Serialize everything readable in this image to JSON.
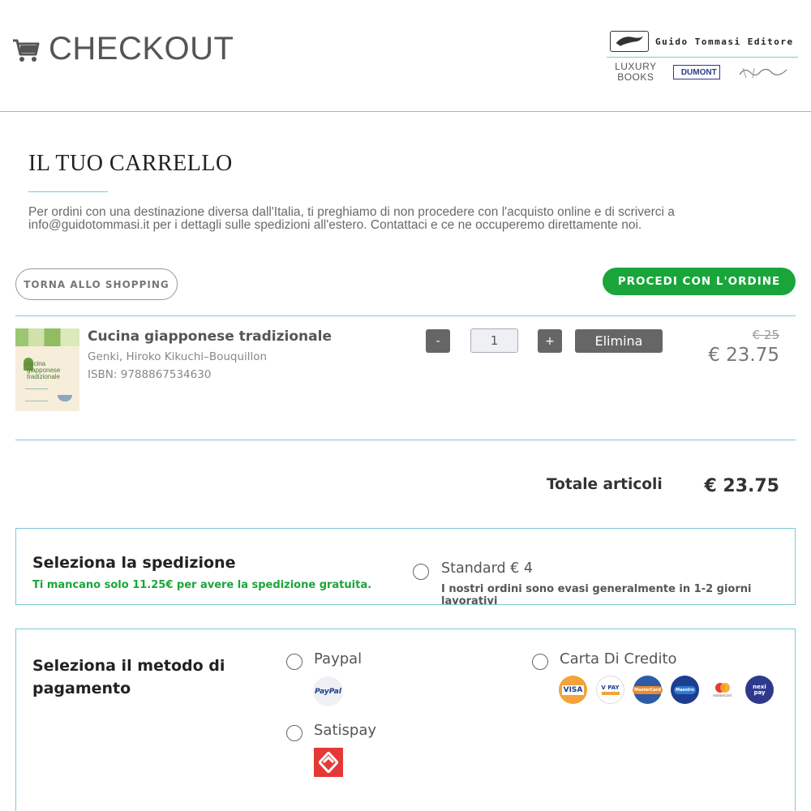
{
  "header": {
    "title": "CHECKOUT",
    "publisher": "Guido Tommasi Editore",
    "luxury_line1": "LUXURY",
    "luxury_line2": "BOOKS",
    "dumont": "DUMONT"
  },
  "cart": {
    "heading": "IL TUO CARRELLO",
    "notice": "Per ordini con una destinazione diversa dall'Italia, ti preghiamo di non procedere con l'acquisto online e di scriverci a info@guidotommasi.it per i dettagli sulle spedizioni all'estero. Contattaci e ce ne occuperemo direttamente noi.",
    "back_button": "TORNA ALLO SHOPPING",
    "proceed_button": "PROCEDI CON L'ORDINE"
  },
  "item": {
    "title": "Cucina giapponese tradizionale",
    "authors": "Genki, Hiroko Kikuchi–Bouquillon",
    "isbn": "ISBN: 9788867534630",
    "cover_text": "cucina giapponese tradizionale",
    "quantity": "1",
    "minus": "-",
    "plus": "+",
    "delete_button": "Elimina",
    "price_old": "€ 25",
    "price_new": "€ 23.75"
  },
  "totals": {
    "label": "Totale articoli",
    "value": "€ 23.75"
  },
  "shipping": {
    "title": "Seleziona la spedizione",
    "note": "Ti mancano solo 11.25€ per avere la spedizione gratuita.",
    "option": "Standard € 4",
    "option_desc": "I nostri ordini sono evasi generalmente in 1-2 giorni lavorativi"
  },
  "payment": {
    "title": "Seleziona il metodo di pagamento",
    "paypal": "Paypal",
    "paypal_logo": "PayPal",
    "satispay": "Satispay",
    "credit_card": "Carta Di Credito",
    "cards": [
      {
        "name": "VISA",
        "color": "#f2a33a"
      },
      {
        "name": "V PAY",
        "color": "#ffffff"
      },
      {
        "name": "MasterCard",
        "color": "#f08a2a"
      },
      {
        "name": "Maestro",
        "color": "#1d3e8f"
      },
      {
        "name": "mastercard",
        "color": "#ffffff"
      },
      {
        "name": "nexi pay",
        "color": "#2d3a8c"
      }
    ]
  },
  "colors": {
    "accent_line": "#7ec8d6",
    "proceed_green": "#1aa53a",
    "button_gray": "#666666"
  }
}
